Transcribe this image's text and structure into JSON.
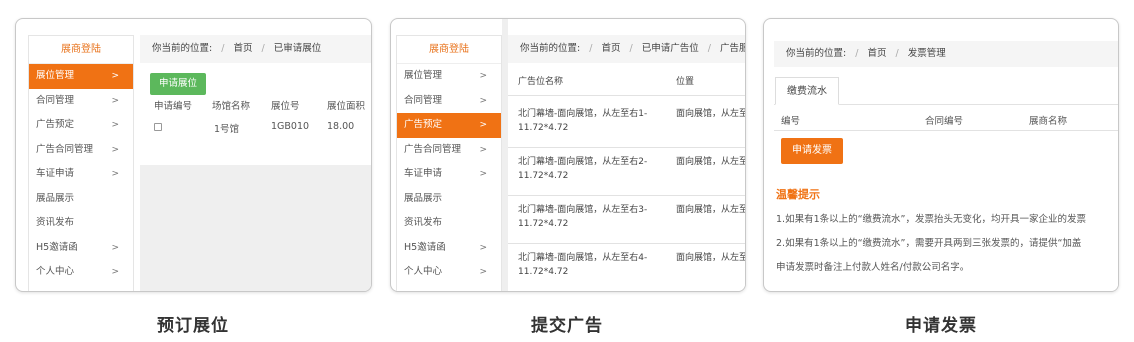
{
  "panel1": {
    "sidebar": {
      "title": "展商登陆",
      "items": [
        {
          "label": "展位管理",
          "arrow": ">"
        },
        {
          "label": "合同管理",
          "arrow": ">"
        },
        {
          "label": "广告预定",
          "arrow": ">"
        },
        {
          "label": "广告合同管理",
          "arrow": ">"
        },
        {
          "label": "车证申请",
          "arrow": ">"
        },
        {
          "label": "展品展示",
          "arrow": ""
        },
        {
          "label": "资讯发布",
          "arrow": ""
        },
        {
          "label": "H5邀请函",
          "arrow": ">"
        },
        {
          "label": "个人中心",
          "arrow": ">"
        }
      ]
    },
    "breadcrumb": {
      "prefix": "你当前的位置:",
      "home": "首页",
      "current": "已审请展位"
    },
    "apply_button": "申请展位",
    "columns": [
      "申请编号",
      "场馆名称",
      "展位号",
      "展位面积"
    ],
    "rows": [
      {
        "hall": "1号馆",
        "booth": "1GB010",
        "area": "18.00"
      }
    ],
    "caption": "预订展位"
  },
  "panel2": {
    "sidebar": {
      "title": "展商登陆",
      "items": [
        {
          "label": "展位管理",
          "arrow": ">"
        },
        {
          "label": "合同管理",
          "arrow": ">"
        },
        {
          "label": "广告预定",
          "arrow": ">"
        },
        {
          "label": "广告合同管理",
          "arrow": ">"
        },
        {
          "label": "车证申请",
          "arrow": ">"
        },
        {
          "label": "展品展示",
          "arrow": ""
        },
        {
          "label": "资讯发布",
          "arrow": ""
        },
        {
          "label": "H5邀请函",
          "arrow": ">"
        },
        {
          "label": "个人中心",
          "arrow": ">"
        }
      ]
    },
    "breadcrumb": {
      "prefix": "你当前的位置:",
      "home": "首页",
      "mid": "已申请广告位",
      "current": "广告服务"
    },
    "columns": [
      "广告位名称",
      "位置"
    ],
    "rows": [
      {
        "name_line1": "北门幕墙-面向展馆，从左至右1-",
        "name_line2": "11.72*4.72",
        "position": "面向展馆，从左至右"
      },
      {
        "name_line1": "北门幕墙-面向展馆，从左至右2-",
        "name_line2": "11.72*4.72",
        "position": "面向展馆，从左至右"
      },
      {
        "name_line1": "北门幕墙-面向展馆，从左至右3-",
        "name_line2": "11.72*4.72",
        "position": "面向展馆，从左至右"
      },
      {
        "name_line1": "北门幕墙-面向展馆，从左至右4-",
        "name_line2": "11.72*4.72",
        "position": "面向展馆，从左至右"
      }
    ],
    "caption": "提交广告"
  },
  "panel3": {
    "breadcrumb": {
      "prefix": "你当前的位置:",
      "home": "首页",
      "current": "发票管理"
    },
    "tab": "缴费流水",
    "columns": [
      "编号",
      "合同编号",
      "展商名称"
    ],
    "apply_button": "申请发票",
    "tips_title": "温馨提示",
    "tips": [
      "1.如果有1条以上的“缴费流水”，发票抬头无变化，均开具一家企业的发票",
      "2.如果有1条以上的“缴费流水”，需要开具两到三张发票的，请提供“加盖",
      "申请发票时备注上付款人姓名/付款公司名字。"
    ],
    "caption": "申请发票"
  },
  "colors": {
    "accent": "#f07214",
    "green": "#5cb85c"
  }
}
